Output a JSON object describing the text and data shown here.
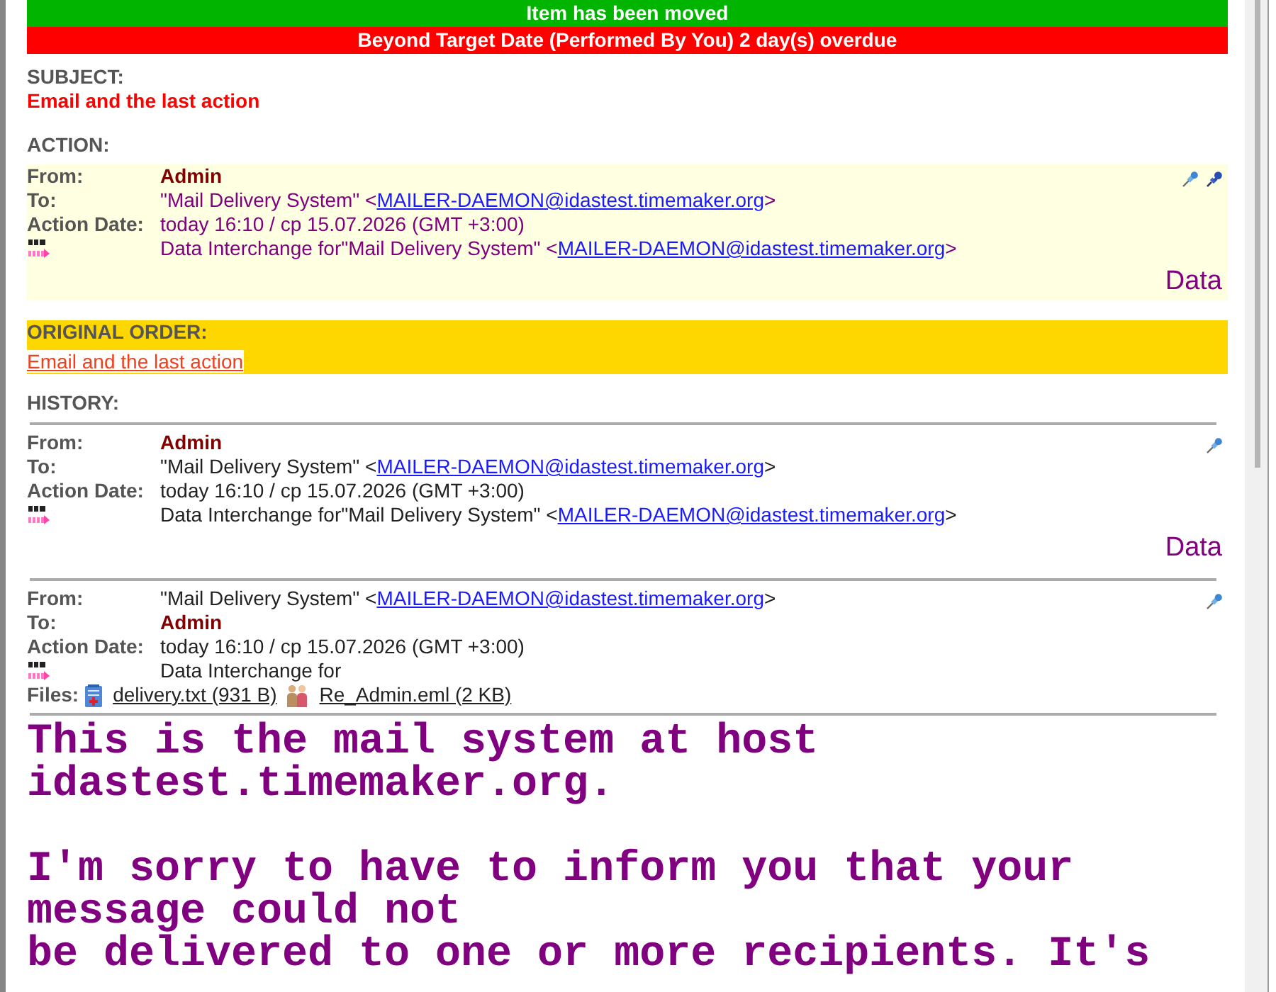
{
  "banners": [
    {
      "text": "Item has been moved",
      "color": "#00b400"
    },
    {
      "text": "Beyond Target Date (Performed By You) 2 day(s) overdue",
      "color": "#ff0000"
    }
  ],
  "subject": {
    "heading": "SUBJECT:",
    "text": "Email and the last action"
  },
  "action": {
    "heading": "ACTION:",
    "entry": {
      "fields": [
        {
          "label": "From:",
          "kind": "user",
          "text": "Admin"
        },
        {
          "label": "To:",
          "kind": "contact",
          "text": "\"Mail Delivery System\" <",
          "email": "MAILER-DAEMON@idastest.timemaker.org",
          "after": ">"
        },
        {
          "label": "Action Date:",
          "kind": "date",
          "text": "today 16:10 / cp 15.07.2026 (GMT +3:00)"
        },
        {
          "kind": "interchange",
          "text": "Data Interchange for\"Mail Delivery System\" <",
          "email": "MAILER-DAEMON@idastest.timemaker.org",
          "after": ">"
        }
      ],
      "tools": [
        {
          "kind": "pin"
        },
        {
          "kind": "tack"
        }
      ],
      "data_link": "Data"
    }
  },
  "original_order": {
    "heading": "ORIGINAL ORDER:",
    "link": "Email and the last action"
  },
  "history": {
    "heading": "HISTORY:",
    "entries": [
      {
        "fields": [
          {
            "label": "From:",
            "kind": "user",
            "text": "Admin"
          },
          {
            "label": "To:",
            "kind": "contact",
            "text": "\"Mail Delivery System\" <",
            "email": "MAILER-DAEMON@idastest.timemaker.org",
            "after": ">"
          },
          {
            "label": "Action Date:",
            "kind": "date",
            "text": "today 16:10 / cp 15.07.2026 (GMT +3:00)"
          },
          {
            "kind": "interchange",
            "text": "Data Interchange for\"Mail Delivery System\" <",
            "email": "MAILER-DAEMON@idastest.timemaker.org",
            "after": ">"
          }
        ],
        "tools": [
          {
            "kind": "pin"
          }
        ],
        "data_link": "Data"
      },
      {
        "fields": [
          {
            "label": "From:",
            "kind": "contact",
            "text": "\"Mail Delivery System\" <",
            "email": "MAILER-DAEMON@idastest.timemaker.org",
            "after": ">"
          },
          {
            "label": "To:",
            "kind": "user",
            "text": "Admin"
          },
          {
            "label": "Action Date:",
            "kind": "date",
            "text": "today 16:10 / cp 15.07.2026 (GMT +3:00)"
          },
          {
            "kind": "interchange",
            "text": "Data Interchange for"
          }
        ],
        "tools": [
          {
            "kind": "pin"
          }
        ],
        "files": {
          "label": "Files:",
          "items": [
            {
              "kind": "text",
              "name": "delivery.txt (931 B)"
            },
            {
              "kind": "mail",
              "name": "Re_Admin.eml (2 KB)"
            }
          ]
        }
      }
    ]
  },
  "message_body": "This is the mail system at host\nidastest.timemaker.org.\n\nI'm sorry to have to inform you that your\nmessage could not\nbe delivered to one or more recipients. It's"
}
